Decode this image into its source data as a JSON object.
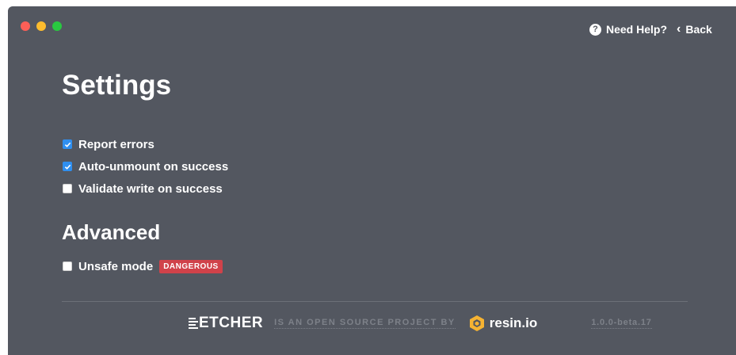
{
  "window": {
    "controls": [
      "close",
      "minimize",
      "zoom"
    ]
  },
  "nav": {
    "help_label": "Need Help?",
    "help_icon": "question-circle-icon",
    "back_label": "Back",
    "back_icon": "chevron-left-icon"
  },
  "settings": {
    "title": "Settings",
    "options": [
      {
        "label": "Report errors",
        "checked": true
      },
      {
        "label": "Auto-unmount on success",
        "checked": true
      },
      {
        "label": "Validate write on success",
        "checked": false
      }
    ]
  },
  "advanced": {
    "title": "Advanced",
    "unsafe": {
      "label": "Unsafe mode",
      "checked": false,
      "badge": "DANGEROUS"
    }
  },
  "footer": {
    "brand": "ETCHER",
    "tagline": "IS AN OPEN SOURCE PROJECT BY",
    "company": "resin.io",
    "version": "1.0.0-beta.17"
  },
  "colors": {
    "background": "#535760",
    "checkbox_checked": "#2f8ff0",
    "danger_badge": "#d0424a",
    "resin_logo": "#f6b332"
  }
}
